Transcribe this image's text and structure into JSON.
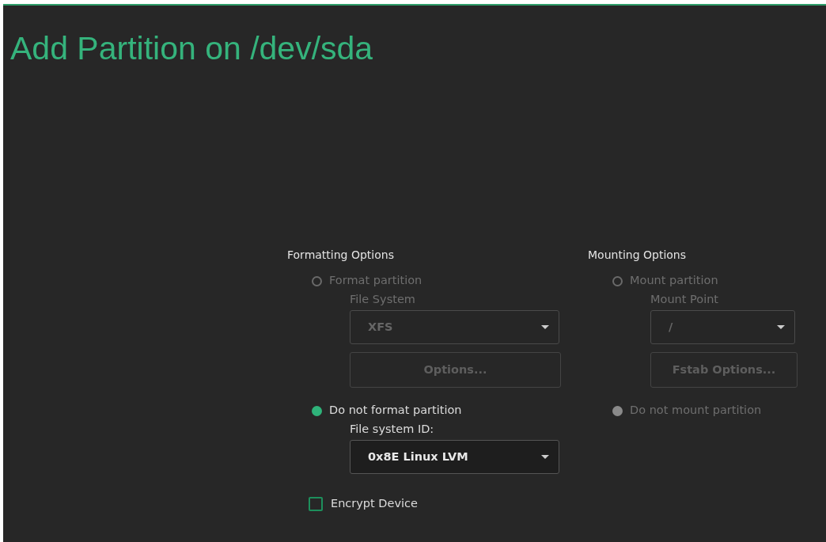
{
  "title": "Add Partition on /dev/sda",
  "columns": [
    {
      "heading": "Formatting Options",
      "items": [
        {
          "kind": "radio",
          "label": "Format partition",
          "selected": false,
          "disabled": true
        },
        {
          "kind": "label",
          "label": "File System",
          "disabled": true
        },
        {
          "kind": "select",
          "value": "XFS",
          "disabled": true
        },
        {
          "kind": "button",
          "label": "Options...",
          "disabled": true
        },
        {
          "kind": "radio",
          "label": "Do not format partition",
          "selected": true,
          "disabled": false
        },
        {
          "kind": "label",
          "label": "File system ID:",
          "disabled": false
        },
        {
          "kind": "select",
          "value": "0x8E Linux LVM",
          "disabled": false
        },
        {
          "kind": "checkbox",
          "label": "Encrypt Device",
          "checked": false
        }
      ]
    },
    {
      "heading": "Mounting Options",
      "items": [
        {
          "kind": "radio",
          "label": "Mount partition",
          "selected": false,
          "disabled": true
        },
        {
          "kind": "label",
          "label": "Mount Point",
          "disabled": true
        },
        {
          "kind": "select",
          "value": "/",
          "disabled": true
        },
        {
          "kind": "button",
          "label": "Fstab Options...",
          "disabled": true
        },
        {
          "kind": "radio",
          "label": "Do not mount partition",
          "selected": true,
          "disabled": true
        }
      ]
    }
  ]
}
